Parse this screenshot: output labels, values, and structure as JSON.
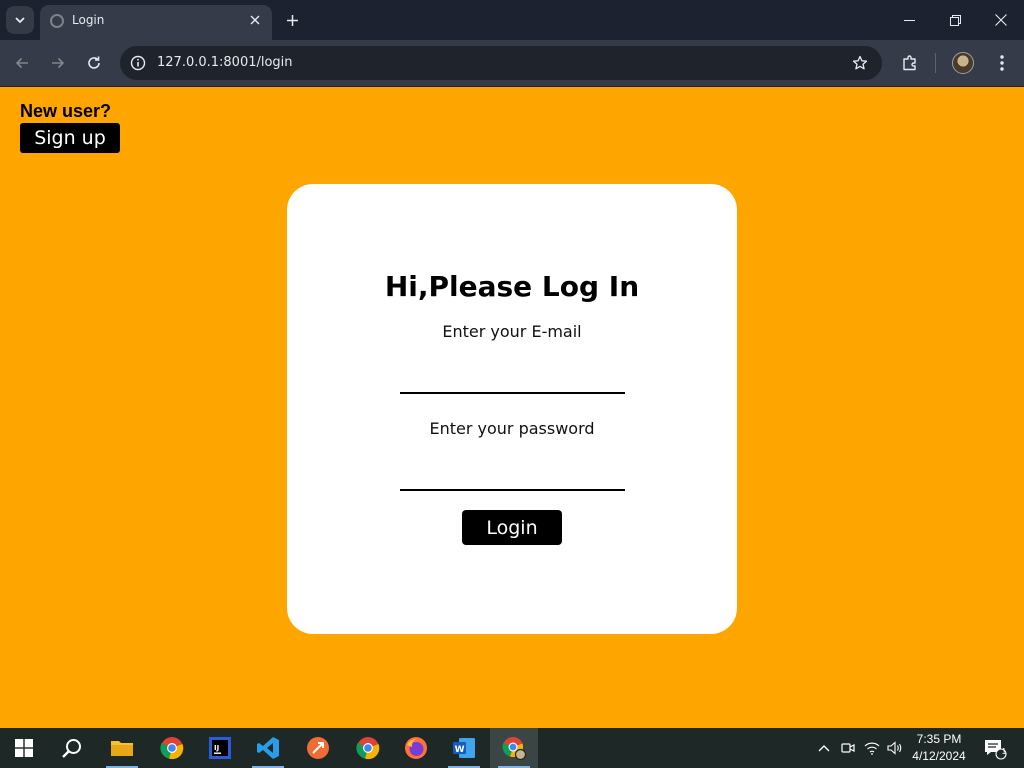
{
  "browser": {
    "tab_title": "Login",
    "url": "127.0.0.1:8001/login"
  },
  "page": {
    "new_user_text": "New user?",
    "signup_label": "Sign up",
    "card_title": "Hi,Please Log In",
    "email_label": "Enter your E-mail",
    "email_value": "",
    "password_label": "Enter your password",
    "password_value": "",
    "login_label": "Login"
  },
  "taskbar": {
    "time": "7:35 PM",
    "date": "4/12/2024",
    "notification_count": "1",
    "apps": [
      "start-icon",
      "search-icon",
      "file-explorer-icon",
      "chrome-icon",
      "intellij-icon",
      "vscode-icon",
      "postman-icon",
      "chrome-icon",
      "firefox-icon",
      "word-icon",
      "chrome-profile-icon"
    ]
  },
  "colors": {
    "page_background": "#ffa500",
    "card_background": "#ffffff",
    "button_background": "#000000",
    "button_text": "#ffffff"
  }
}
